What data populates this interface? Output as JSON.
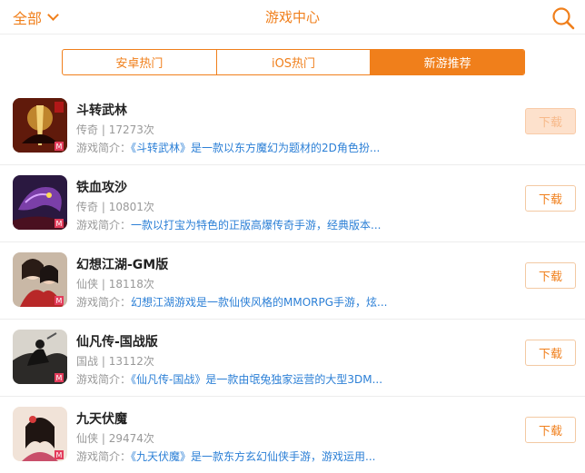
{
  "header": {
    "filter_label": "全部",
    "title": "游戏中心"
  },
  "tabs": [
    {
      "label": "安卓热门",
      "active": false
    },
    {
      "label": "iOS热门",
      "active": false
    },
    {
      "label": "新游推荐",
      "active": true
    }
  ],
  "games": [
    {
      "name": "斗转武林",
      "genre": "传奇",
      "count": "17273次",
      "desc_label": "游戏简介：",
      "desc": "《斗转武林》是一款以东方魔幻为题材的2D角色扮...",
      "button": "下载",
      "pressed": true
    },
    {
      "name": "铁血攻沙",
      "genre": "传奇",
      "count": "10801次",
      "desc_label": "游戏简介：",
      "desc": "一款以打宝为特色的正版高爆传奇手游，经典版本...",
      "button": "下载",
      "pressed": false
    },
    {
      "name": "幻想江湖-GM版",
      "genre": "仙侠",
      "count": "18118次",
      "desc_label": "游戏简介：",
      "desc": "幻想江湖游戏是一款仙侠风格的MMORPG手游，炫...",
      "button": "下载",
      "pressed": false
    },
    {
      "name": "仙凡传-国战版",
      "genre": "国战",
      "count": "13112次",
      "desc_label": "游戏简介：",
      "desc": "《仙凡传-国战》是一款由氓兔独家运营的大型3DM...",
      "button": "下载",
      "pressed": false
    },
    {
      "name": "九天伏魔",
      "genre": "仙侠",
      "count": "29474次",
      "desc_label": "游戏简介：",
      "desc": "《九天伏魔》是一款东方玄幻仙侠手游，游戏运用...",
      "button": "下载",
      "pressed": false
    }
  ],
  "colors": {
    "accent": "#f07f1b",
    "link": "#2b7fd6",
    "muted": "#999999"
  }
}
